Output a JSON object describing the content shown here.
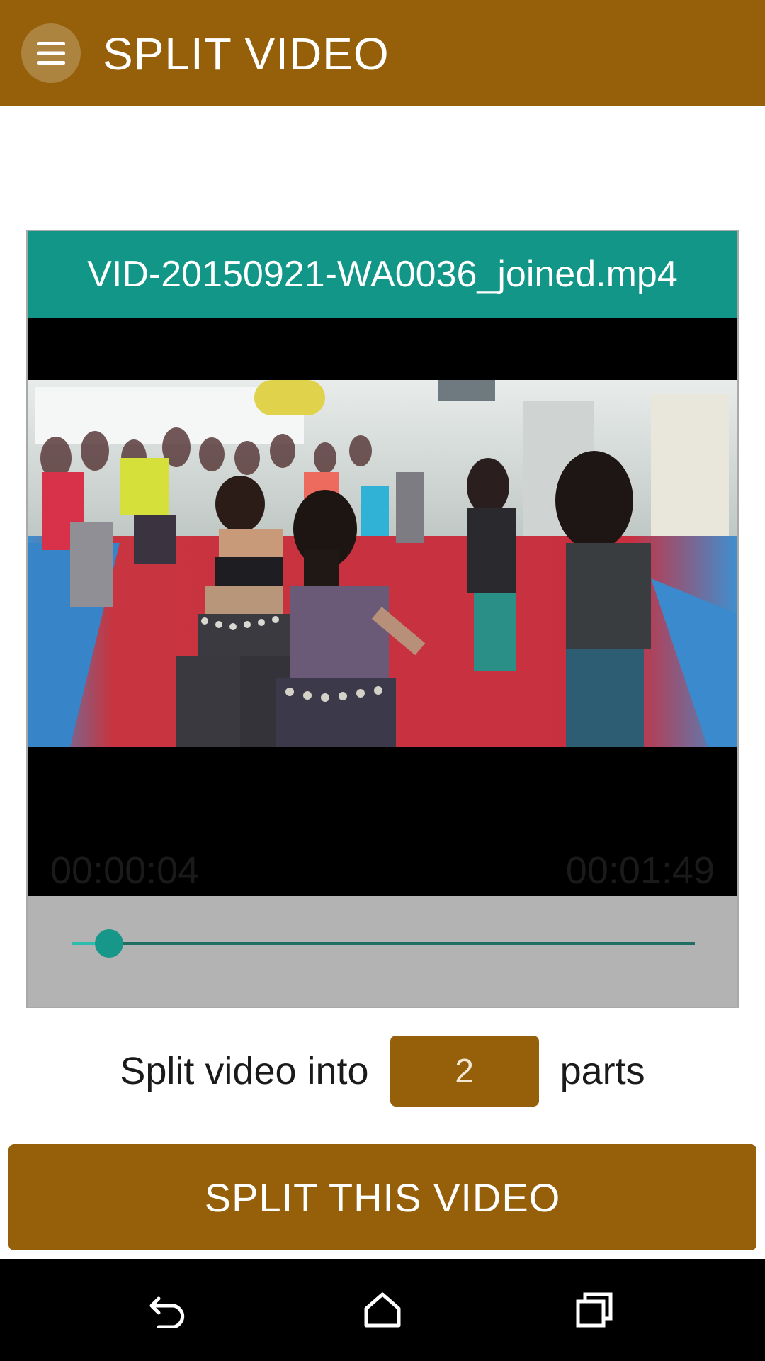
{
  "app_bar": {
    "title": "SPLIT VIDEO",
    "menu_icon": "hamburger-menu-icon",
    "background": "#956009"
  },
  "video": {
    "file_name": "VID-20150921-WA0036_joined.mp4",
    "header_color": "#119688",
    "current_time": "00:00:04",
    "total_time": "00:01:49",
    "seek_fraction": 0.06
  },
  "split": {
    "label_before": "Split video into",
    "parts_value": "2",
    "label_after": "parts"
  },
  "action": {
    "split_button_label": "SPLIT THIS VIDEO"
  },
  "system_nav": {
    "back_icon": "back-icon",
    "home_icon": "home-icon",
    "recents_icon": "recents-icon"
  }
}
